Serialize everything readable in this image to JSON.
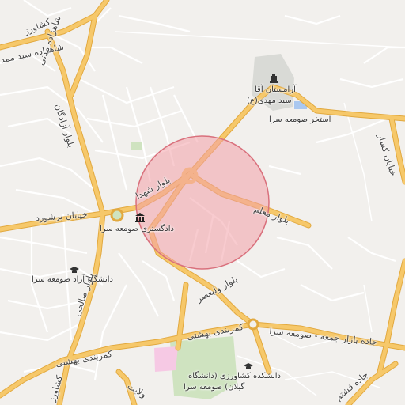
{
  "labels": {
    "l1": "کشاورز",
    "l2": "شاهزاده سید ممد",
    "l3": "شاهزاده مدنی",
    "l4": "بلوار آزادگان",
    "l5": "بلوار شهدا",
    "l6": "بلوار معلم",
    "l7": "خیابان برشورد",
    "l8": "دادگستری صومعه سرا",
    "l9": "آرامستان آقا",
    "l10": "سید مهدی(ع)",
    "l11": "استخر صومعه سرا",
    "l12": "دانشگاه آزاد صومعه سرا",
    "l13": "بلوار صالحی",
    "l14": "بلوار ولیعصر",
    "l15": "کمربندی بهشتی",
    "l16": "جاده بازار جمعه - صومعه سرا",
    "l17": "کمربندی بهشتی",
    "l18": "دانشکده کشاورزی (دانشگاه",
    "l19": "گیلان) صومعه سرا",
    "l20": "ولایت",
    "l21": "جاده فشتم",
    "l22": "کشاورز",
    "l23": "خیابان کسار"
  },
  "icons": {
    "cemetery": "monument-icon",
    "courthouse": "courthouse-icon",
    "university": "graduation-cap-icon",
    "faculty": "graduation-cap-icon"
  },
  "colors": {
    "background": "#f2f0ed",
    "major_road": "#f6c86a",
    "major_road_edge": "#e2a93f",
    "minor_road": "#ffffff",
    "highlight_fill": "#f2a0a8",
    "highlight_stroke": "#d9707c",
    "green_area": "#cfe3c0",
    "pink_area": "#f6c9e4",
    "water": "#aac8f0"
  }
}
